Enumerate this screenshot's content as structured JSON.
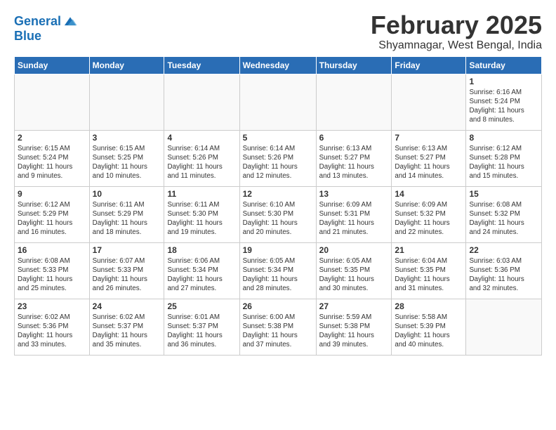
{
  "header": {
    "logo_line1": "General",
    "logo_line2": "Blue",
    "title": "February 2025",
    "subtitle": "Shyamnagar, West Bengal, India"
  },
  "weekdays": [
    "Sunday",
    "Monday",
    "Tuesday",
    "Wednesday",
    "Thursday",
    "Friday",
    "Saturday"
  ],
  "weeks": [
    [
      {
        "day": "",
        "info": ""
      },
      {
        "day": "",
        "info": ""
      },
      {
        "day": "",
        "info": ""
      },
      {
        "day": "",
        "info": ""
      },
      {
        "day": "",
        "info": ""
      },
      {
        "day": "",
        "info": ""
      },
      {
        "day": "1",
        "info": "Sunrise: 6:16 AM\nSunset: 5:24 PM\nDaylight: 11 hours\nand 8 minutes."
      }
    ],
    [
      {
        "day": "2",
        "info": "Sunrise: 6:15 AM\nSunset: 5:24 PM\nDaylight: 11 hours\nand 9 minutes."
      },
      {
        "day": "3",
        "info": "Sunrise: 6:15 AM\nSunset: 5:25 PM\nDaylight: 11 hours\nand 10 minutes."
      },
      {
        "day": "4",
        "info": "Sunrise: 6:14 AM\nSunset: 5:26 PM\nDaylight: 11 hours\nand 11 minutes."
      },
      {
        "day": "5",
        "info": "Sunrise: 6:14 AM\nSunset: 5:26 PM\nDaylight: 11 hours\nand 12 minutes."
      },
      {
        "day": "6",
        "info": "Sunrise: 6:13 AM\nSunset: 5:27 PM\nDaylight: 11 hours\nand 13 minutes."
      },
      {
        "day": "7",
        "info": "Sunrise: 6:13 AM\nSunset: 5:27 PM\nDaylight: 11 hours\nand 14 minutes."
      },
      {
        "day": "8",
        "info": "Sunrise: 6:12 AM\nSunset: 5:28 PM\nDaylight: 11 hours\nand 15 minutes."
      }
    ],
    [
      {
        "day": "9",
        "info": "Sunrise: 6:12 AM\nSunset: 5:29 PM\nDaylight: 11 hours\nand 16 minutes."
      },
      {
        "day": "10",
        "info": "Sunrise: 6:11 AM\nSunset: 5:29 PM\nDaylight: 11 hours\nand 18 minutes."
      },
      {
        "day": "11",
        "info": "Sunrise: 6:11 AM\nSunset: 5:30 PM\nDaylight: 11 hours\nand 19 minutes."
      },
      {
        "day": "12",
        "info": "Sunrise: 6:10 AM\nSunset: 5:30 PM\nDaylight: 11 hours\nand 20 minutes."
      },
      {
        "day": "13",
        "info": "Sunrise: 6:09 AM\nSunset: 5:31 PM\nDaylight: 11 hours\nand 21 minutes."
      },
      {
        "day": "14",
        "info": "Sunrise: 6:09 AM\nSunset: 5:32 PM\nDaylight: 11 hours\nand 22 minutes."
      },
      {
        "day": "15",
        "info": "Sunrise: 6:08 AM\nSunset: 5:32 PM\nDaylight: 11 hours\nand 24 minutes."
      }
    ],
    [
      {
        "day": "16",
        "info": "Sunrise: 6:08 AM\nSunset: 5:33 PM\nDaylight: 11 hours\nand 25 minutes."
      },
      {
        "day": "17",
        "info": "Sunrise: 6:07 AM\nSunset: 5:33 PM\nDaylight: 11 hours\nand 26 minutes."
      },
      {
        "day": "18",
        "info": "Sunrise: 6:06 AM\nSunset: 5:34 PM\nDaylight: 11 hours\nand 27 minutes."
      },
      {
        "day": "19",
        "info": "Sunrise: 6:05 AM\nSunset: 5:34 PM\nDaylight: 11 hours\nand 28 minutes."
      },
      {
        "day": "20",
        "info": "Sunrise: 6:05 AM\nSunset: 5:35 PM\nDaylight: 11 hours\nand 30 minutes."
      },
      {
        "day": "21",
        "info": "Sunrise: 6:04 AM\nSunset: 5:35 PM\nDaylight: 11 hours\nand 31 minutes."
      },
      {
        "day": "22",
        "info": "Sunrise: 6:03 AM\nSunset: 5:36 PM\nDaylight: 11 hours\nand 32 minutes."
      }
    ],
    [
      {
        "day": "23",
        "info": "Sunrise: 6:02 AM\nSunset: 5:36 PM\nDaylight: 11 hours\nand 33 minutes."
      },
      {
        "day": "24",
        "info": "Sunrise: 6:02 AM\nSunset: 5:37 PM\nDaylight: 11 hours\nand 35 minutes."
      },
      {
        "day": "25",
        "info": "Sunrise: 6:01 AM\nSunset: 5:37 PM\nDaylight: 11 hours\nand 36 minutes."
      },
      {
        "day": "26",
        "info": "Sunrise: 6:00 AM\nSunset: 5:38 PM\nDaylight: 11 hours\nand 37 minutes."
      },
      {
        "day": "27",
        "info": "Sunrise: 5:59 AM\nSunset: 5:38 PM\nDaylight: 11 hours\nand 39 minutes."
      },
      {
        "day": "28",
        "info": "Sunrise: 5:58 AM\nSunset: 5:39 PM\nDaylight: 11 hours\nand 40 minutes."
      },
      {
        "day": "",
        "info": ""
      }
    ]
  ]
}
